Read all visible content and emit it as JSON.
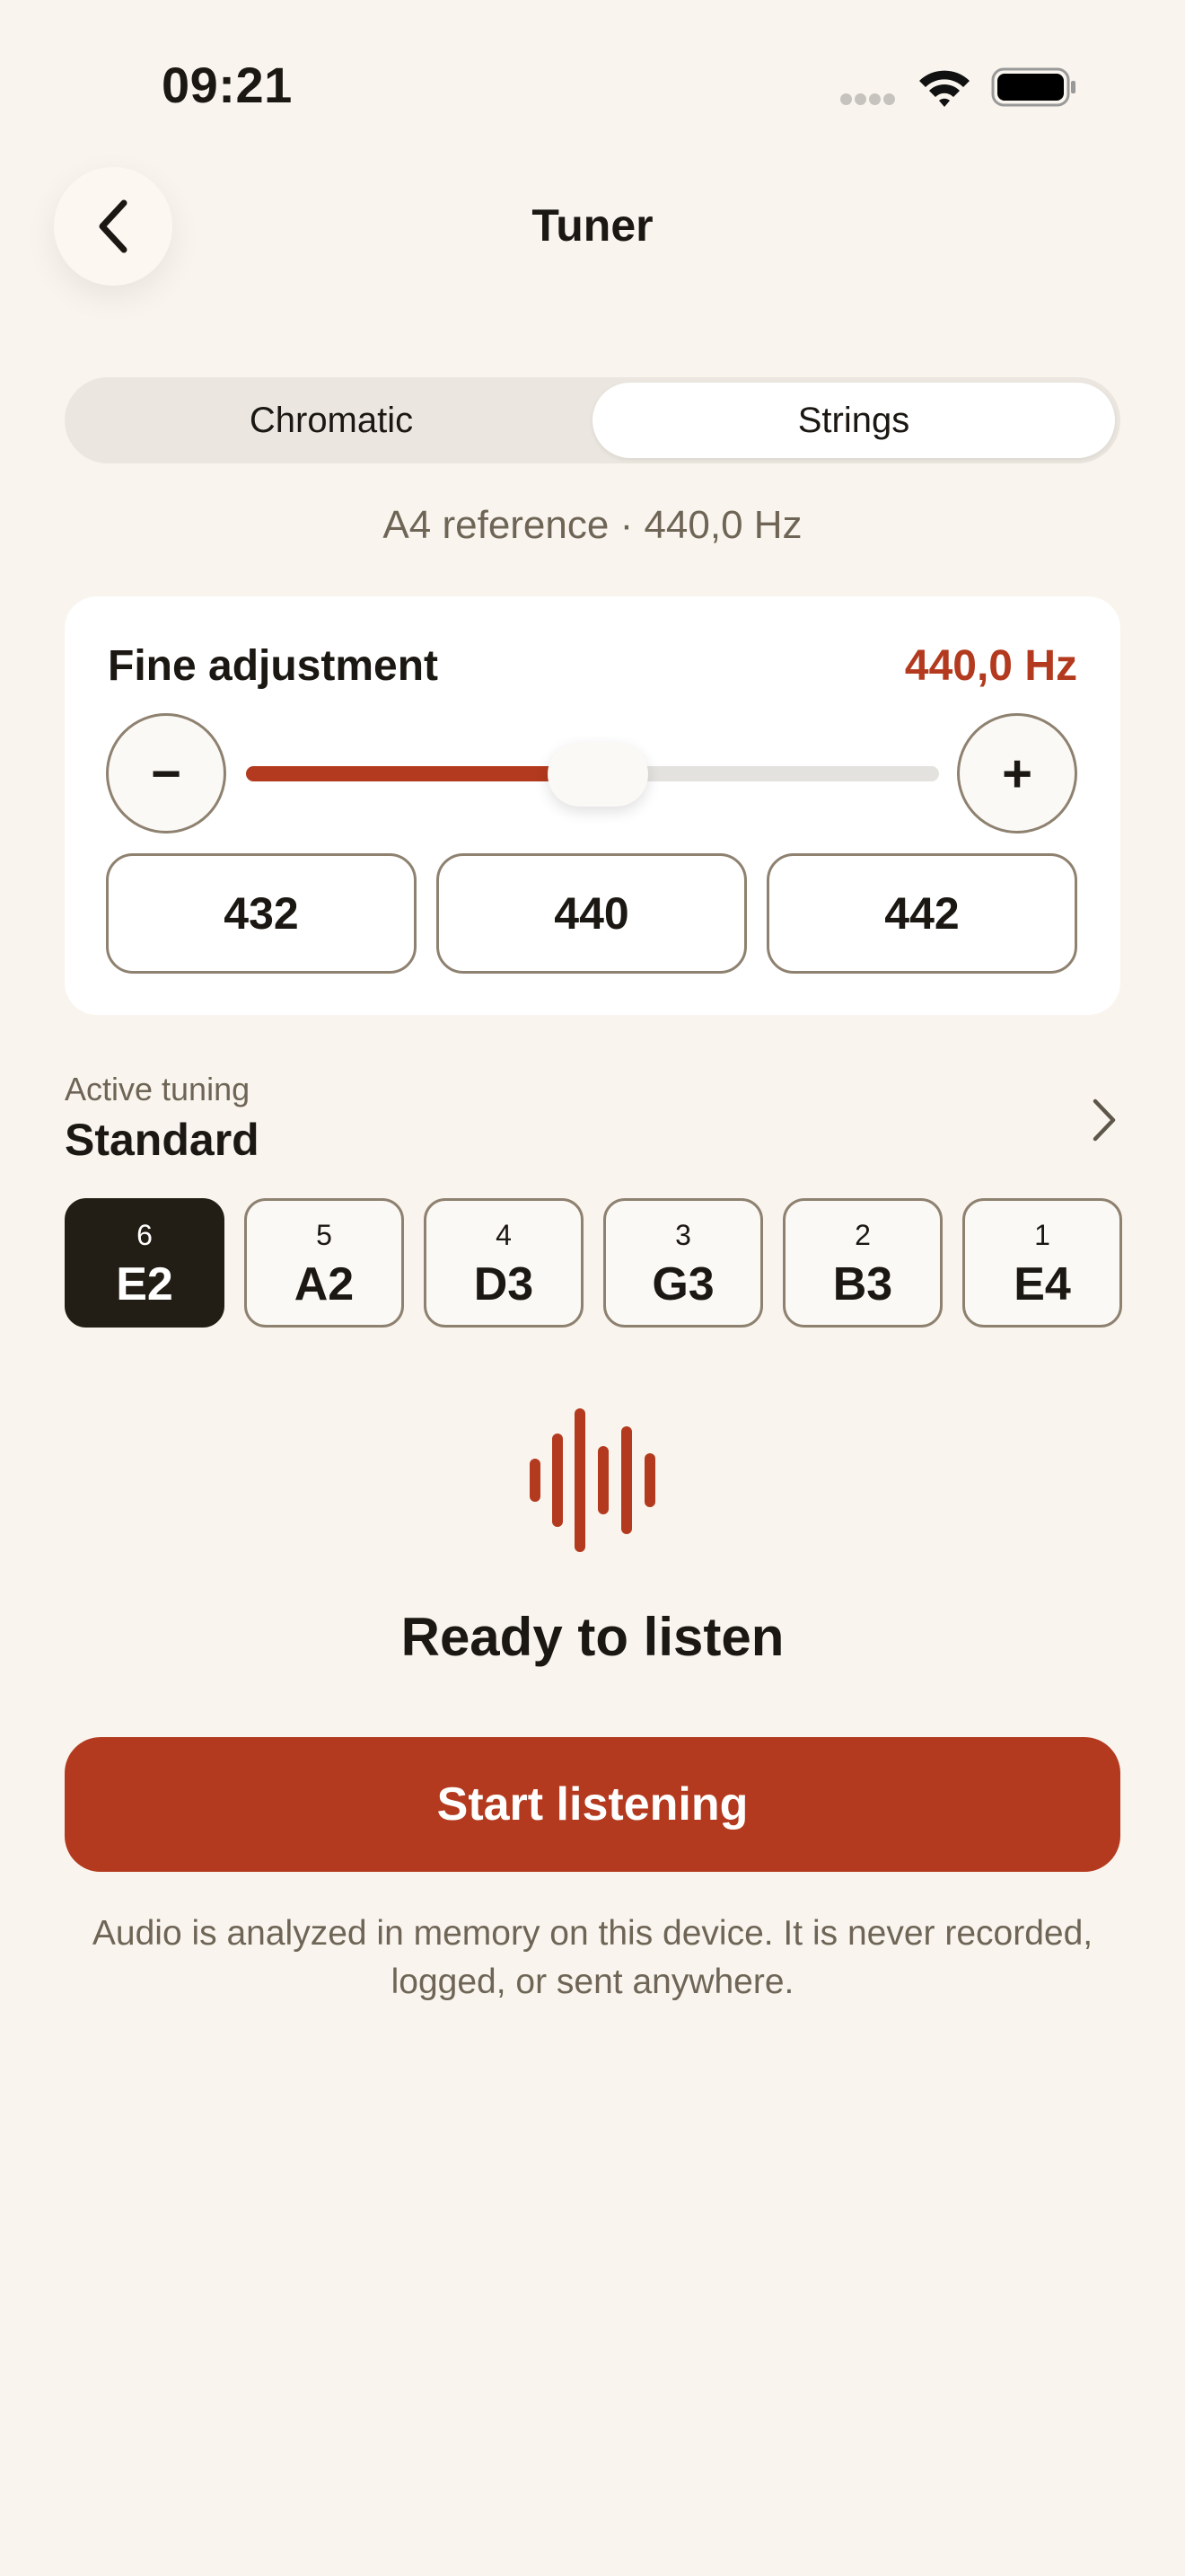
{
  "status_bar": {
    "time": "09:21"
  },
  "nav": {
    "title": "Tuner"
  },
  "mode_tabs": [
    {
      "label": "Chromatic",
      "selected": false
    },
    {
      "label": "Strings",
      "selected": true
    }
  ],
  "reference_text": "A4 reference · 440,0 Hz",
  "fine_adjustment": {
    "label": "Fine adjustment",
    "value_text": "440,0 Hz",
    "decrement_label": "−",
    "increment_label": "+",
    "slider_fraction": 0.5,
    "presets": [
      "432",
      "440",
      "442"
    ]
  },
  "tuning": {
    "caption": "Active tuning",
    "name": "Standard",
    "strings": [
      {
        "number": "6",
        "note": "E2",
        "selected": true
      },
      {
        "number": "5",
        "note": "A2",
        "selected": false
      },
      {
        "number": "4",
        "note": "D3",
        "selected": false
      },
      {
        "number": "3",
        "note": "G3",
        "selected": false
      },
      {
        "number": "2",
        "note": "B3",
        "selected": false
      },
      {
        "number": "1",
        "note": "E4",
        "selected": false
      }
    ]
  },
  "listening": {
    "status": "Ready to listen",
    "button_label": "Start listening",
    "privacy_note": "Audio is analyzed in memory on this device. It is never recorded, logged, or sent anywhere."
  },
  "colors": {
    "accent": "#b33a1e",
    "background": "#f9f5ee",
    "selected_string": "#231e15"
  },
  "icons": [
    "cellular-signal-icon",
    "wifi-icon",
    "battery-icon",
    "back-chevron-icon",
    "chevron-right-icon",
    "waveform-icon"
  ]
}
